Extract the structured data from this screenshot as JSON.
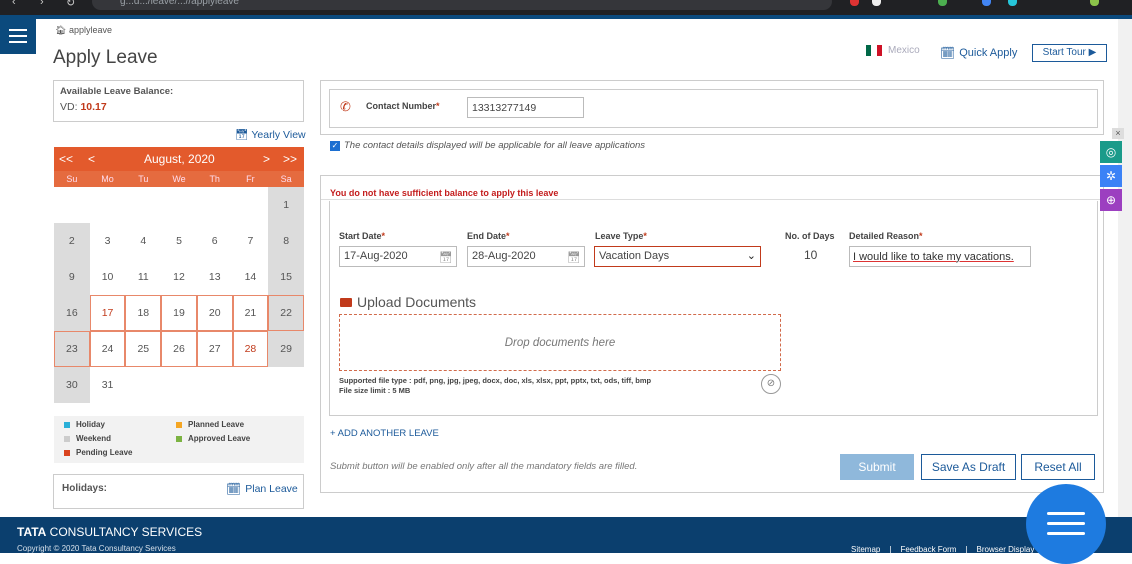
{
  "browser": {
    "url": "g...d.../leave/...//applyleave"
  },
  "header": {
    "breadcrumb": "applyleave",
    "title": "Apply Leave",
    "country": "Mexico",
    "quick_apply": "Quick Apply",
    "start_tour": "Start Tour ▶"
  },
  "balance": {
    "label": "Available Leave Balance:",
    "code": "VD:",
    "value": "10.17"
  },
  "yearly_view": "Yearly View",
  "calendar": {
    "prev_year": "<<",
    "prev_month": "<",
    "month_label": "August, 2020",
    "next_month": ">",
    "next_year": ">>",
    "weekdays": [
      "Su",
      "Mo",
      "Tu",
      "We",
      "Th",
      "Fr",
      "Sa"
    ],
    "weeks": [
      [
        "",
        "",
        "",
        "",
        "",
        "",
        "1"
      ],
      [
        "2",
        "3",
        "4",
        "5",
        "6",
        "7",
        "8"
      ],
      [
        "9",
        "10",
        "11",
        "12",
        "13",
        "14",
        "15"
      ],
      [
        "16",
        "17",
        "18",
        "19",
        "20",
        "21",
        "22"
      ],
      [
        "23",
        "24",
        "25",
        "26",
        "27",
        "28",
        "29"
      ],
      [
        "30",
        "31",
        "",
        "",
        "",
        "",
        ""
      ]
    ]
  },
  "legend": {
    "holiday": "Holiday",
    "weekend": "Weekend",
    "pending": "Pending Leave",
    "planned": "Planned Leave",
    "approved": "Approved Leave",
    "colors": {
      "holiday": "#2bb0d8",
      "weekend": "#cccccc",
      "pending": "#d9431e",
      "planned": "#f5a623",
      "approved": "#7cb342"
    }
  },
  "holidays": {
    "label": "Holidays:",
    "plan_leave": "Plan Leave"
  },
  "contact": {
    "label": "Contact Number",
    "required": "*",
    "value": "13313277149",
    "consent": "The contact details displayed will be applicable for all leave applications"
  },
  "error": "You do not have sufficient balance to apply this leave",
  "form": {
    "start_label": "Start Date",
    "start_value": "17-Aug-2020",
    "end_label": "End Date",
    "end_value": "28-Aug-2020",
    "type_label": "Leave Type",
    "type_value": "Vacation Days",
    "days_label": "No. of Days",
    "days_value": "10",
    "reason_label": "Detailed Reason",
    "reason_value": "I would like to take my vacations.",
    "required": "*"
  },
  "upload": {
    "title": "Upload Documents",
    "drop": "Drop documents here",
    "types": "Supported file type : pdf, png, jpg, jpeg, docx, doc, xls, xlsx, ppt, pptx, txt, ods, tiff, bmp",
    "limit": "File size limit : 5 MB"
  },
  "add_leave": "+ ADD ANOTHER LEAVE",
  "submit_note": "Submit button will be enabled only after all the mandatory fields are filled.",
  "buttons": {
    "submit": "Submit",
    "draft": "Save As Draft",
    "reset": "Reset All"
  },
  "footer": {
    "brand_bold": "TATA",
    "brand_rest": " CONSULTANCY SERVICES",
    "copyright": "Copyright © 2020 Tata Consultancy Services",
    "links": [
      "Sitemap",
      "|",
      "Feedback Form",
      "|",
      "Browser Display"
    ]
  }
}
